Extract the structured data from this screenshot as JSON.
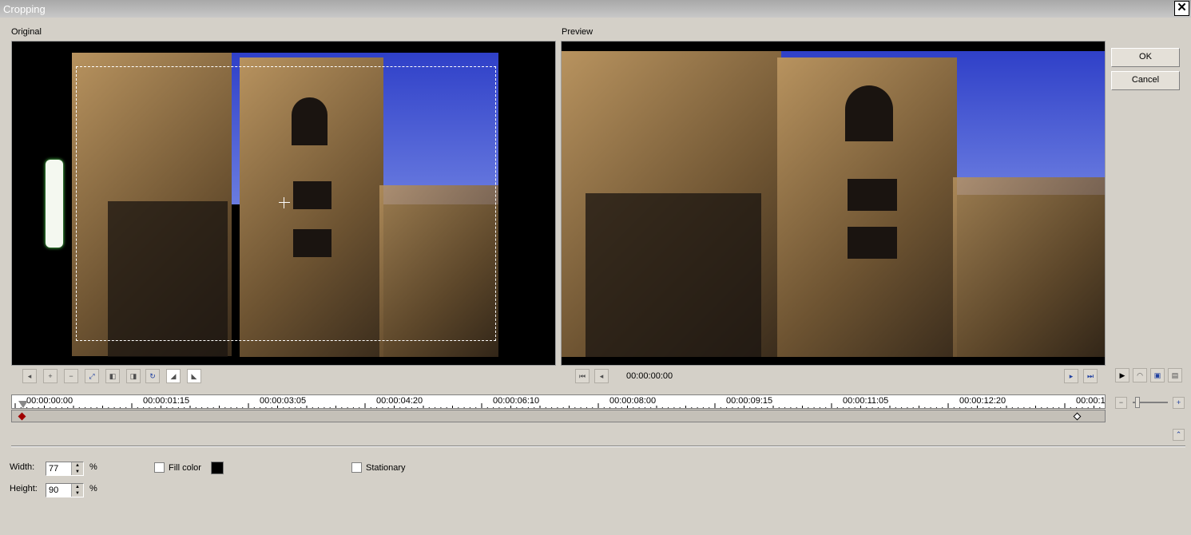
{
  "window": {
    "title": "Cropping",
    "close": "✕"
  },
  "labels": {
    "original": "Original",
    "preview": "Preview"
  },
  "buttons": {
    "ok": "OK",
    "cancel": "Cancel"
  },
  "preview_timecode": "00:00:00:00",
  "timeline": {
    "labels": [
      "00:00:00:00",
      "00:00:01:15",
      "00:00:03:05",
      "00:00:04:20",
      "00:00:06:10",
      "00:00:08:00",
      "00:00:09:15",
      "00:00:11:05",
      "00:00:12:20",
      "00:00:1"
    ]
  },
  "settings": {
    "width_label": "Width:",
    "width_value": "77",
    "width_unit": "%",
    "height_label": "Height:",
    "height_value": "90",
    "height_unit": "%",
    "fill_color_label": "Fill color",
    "fill_color": "#000000",
    "stationary_label": "Stationary"
  },
  "icons": {
    "close": "close-icon",
    "play": "play-icon",
    "zoom_out": "zoom-out-icon",
    "zoom_in": "zoom-in-icon",
    "collapse": "collapse-up-icon"
  }
}
